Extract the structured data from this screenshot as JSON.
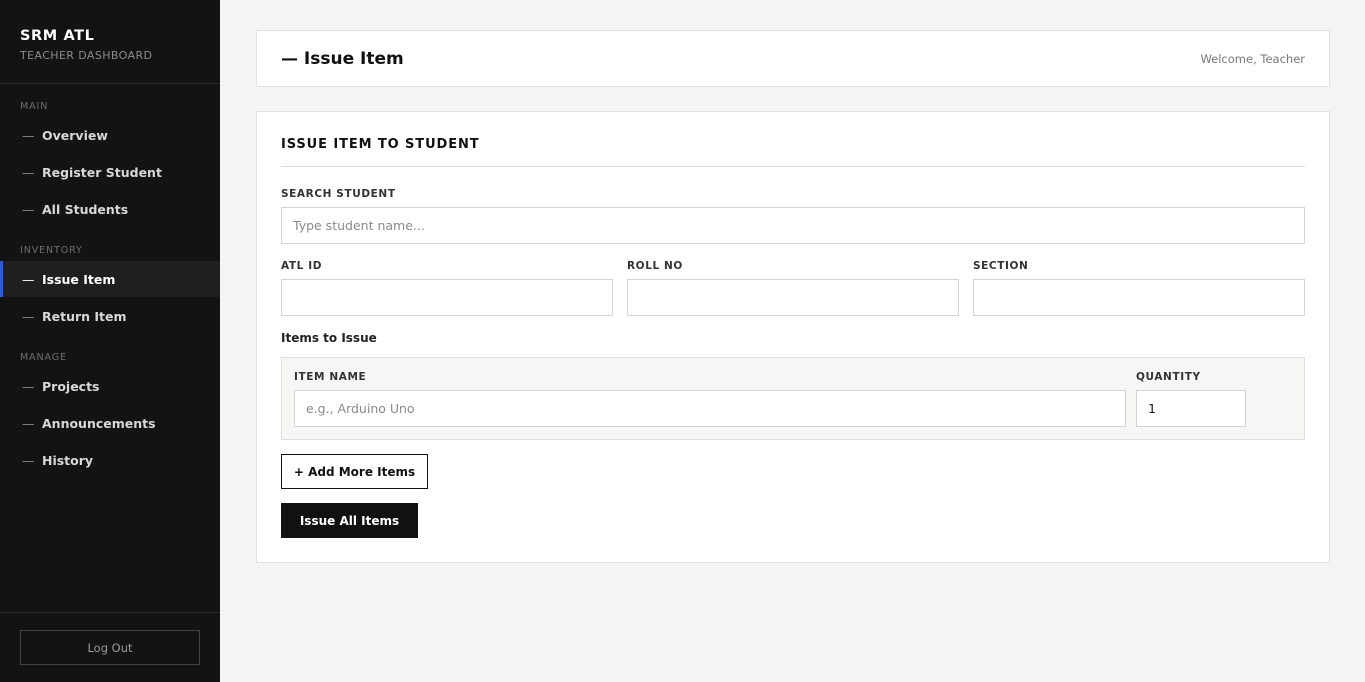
{
  "sidebar": {
    "brand_title": "SRM ATL",
    "brand_subtitle": "TEACHER DASHBOARD",
    "sections": [
      "MAIN",
      "INVENTORY",
      "MANAGE"
    ],
    "items": [
      {
        "label": "Overview",
        "icon": "dash-icon"
      },
      {
        "label": "Register Student",
        "icon": "dash-icon"
      },
      {
        "label": "All Students",
        "icon": "dash-icon"
      },
      {
        "label": "Issue Item",
        "icon": "dash-icon",
        "active": true
      },
      {
        "label": "Return Item",
        "icon": "dash-icon"
      },
      {
        "label": "Projects",
        "icon": "dash-icon"
      },
      {
        "label": "Announcements",
        "icon": "dash-icon"
      },
      {
        "label": "History",
        "icon": "dash-icon"
      }
    ],
    "dash_glyph": "—",
    "logout_label": "Log Out"
  },
  "header": {
    "title": "— Issue Item",
    "welcome": "Welcome, Teacher"
  },
  "form": {
    "title": "ISSUE ITEM TO STUDENT",
    "search_label": "SEARCH STUDENT",
    "search_placeholder": "Type student name...",
    "search_value": "",
    "atl_id_label": "ATL ID",
    "atl_id_value": "",
    "roll_no_label": "ROLL NO",
    "roll_no_value": "",
    "section_label": "SECTION",
    "section_value": "",
    "items_heading": "Items to Issue",
    "item_name_label": "ITEM NAME",
    "item_name_placeholder": "e.g., Arduino Uno",
    "quantity_label": "QUANTITY",
    "quantity_value": "1",
    "add_more_label": "+ Add More Items",
    "issue_all_label": "Issue All Items"
  },
  "colors": {
    "sidebar_bg": "#131313",
    "active_accent": "#2f5bd8",
    "page_bg": "#f4f4f2",
    "primary_button": "#111111"
  }
}
